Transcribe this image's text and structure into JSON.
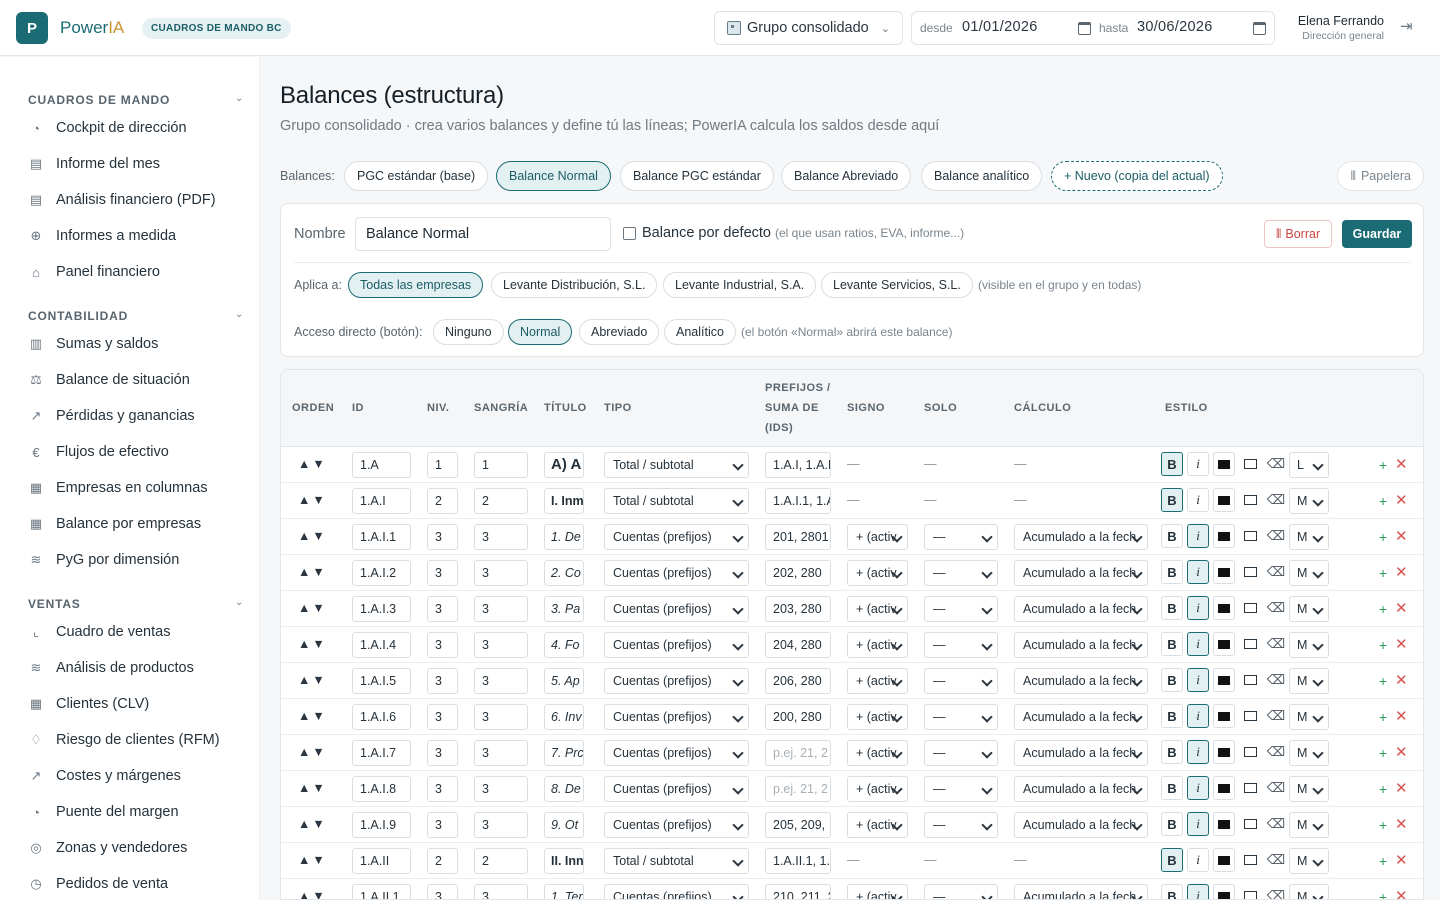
{
  "header": {
    "logo_letter": "P",
    "brand_a": "Power",
    "brand_b": "IA",
    "badge": "CUADROS DE MANDO BC",
    "group": "Grupo consolidado",
    "from_label": "desde",
    "from_date": "01/01/2026",
    "to_label": "hasta",
    "to_date": "30/06/2026",
    "user_name": "Elena Ferrando",
    "user_role": "Dirección general"
  },
  "sidebar": {
    "sections": [
      {
        "title": "CUADROS DE MANDO",
        "items": [
          {
            "label": "Cockpit de dirección",
            "icon": "gauge-icon",
            "glyph": "◔"
          },
          {
            "label": "Informe del mes",
            "icon": "document-icon",
            "glyph": "▤"
          },
          {
            "label": "Análisis financiero (PDF)",
            "icon": "document-icon",
            "glyph": "▤"
          },
          {
            "label": "Informes a medida",
            "icon": "plus-circle-icon",
            "glyph": "⊕"
          },
          {
            "label": "Panel financiero",
            "icon": "home-icon",
            "glyph": "⌂"
          }
        ]
      },
      {
        "title": "CONTABILIDAD",
        "items": [
          {
            "label": "Sumas y saldos",
            "icon": "book-icon",
            "glyph": "▥"
          },
          {
            "label": "Balance de situación",
            "icon": "scale-icon",
            "glyph": "⚖"
          },
          {
            "label": "Pérdidas y ganancias",
            "icon": "trend-icon",
            "glyph": "↗"
          },
          {
            "label": "Flujos de efectivo",
            "icon": "euro-icon",
            "glyph": "€"
          },
          {
            "label": "Empresas en columnas",
            "icon": "building-icon",
            "glyph": "▦"
          },
          {
            "label": "Balance por empresas",
            "icon": "building-icon",
            "glyph": "▦"
          },
          {
            "label": "PyG por dimensión",
            "icon": "layers-icon",
            "glyph": "≋"
          }
        ]
      },
      {
        "title": "VENTAS",
        "items": [
          {
            "label": "Cuadro de ventas",
            "icon": "line-chart-icon",
            "glyph": "⌞"
          },
          {
            "label": "Análisis de productos",
            "icon": "layers-icon",
            "glyph": "≋"
          },
          {
            "label": "Clientes (CLV)",
            "icon": "building-icon",
            "glyph": "▦"
          },
          {
            "label": "Riesgo de clientes (RFM)",
            "icon": "bell-icon",
            "glyph": "♢"
          },
          {
            "label": "Costes y márgenes",
            "icon": "trend-icon",
            "glyph": "↗"
          },
          {
            "label": "Puente del margen",
            "icon": "gauge-icon",
            "glyph": "◔"
          },
          {
            "label": "Zonas y vendedores",
            "icon": "target-icon",
            "glyph": "◎"
          },
          {
            "label": "Pedidos de venta",
            "icon": "clock-icon",
            "glyph": "◷"
          }
        ]
      }
    ]
  },
  "page": {
    "title": "Balances (estructura)",
    "subtitle": "Grupo consolidado · crea varios balances y define tú las líneas; PowerIA calcula los saldos desde aquí",
    "balances_label": "Balances:",
    "balances": [
      "PGC estándar (base)",
      "Balance Normal",
      "Balance PGC estándar",
      "Balance Abreviado",
      "Balance analítico"
    ],
    "new_balance": "+ Nuevo (copia del actual)",
    "trash": "Papelera"
  },
  "form": {
    "name_label": "Nombre",
    "name_value": "Balance Normal",
    "default_label": "Balance por defecto",
    "default_hint": "(el que usan ratios, EVA, informe...)",
    "delete": "Borrar",
    "save": "Guardar",
    "applies_label": "Aplica a:",
    "applies": [
      "Todas las empresas",
      "Levante Distribución, S.L.",
      "Levante Industrial, S.A.",
      "Levante Servicios, S.L."
    ],
    "applies_hint": "(visible en el grupo y en todas)",
    "shortcut_label": "Acceso directo (botón):",
    "shortcuts": [
      "Ninguno",
      "Normal",
      "Abreviado",
      "Analítico"
    ],
    "shortcut_hint": "(el botón «Normal» abrirá este balance)"
  },
  "table": {
    "headers": {
      "orden": "ORDEN",
      "id": "ID",
      "niv": "NIV.",
      "sangria": "SANGRÍA",
      "titulo": "TÍTULO",
      "tipo": "TIPO",
      "prefijos1": "PREFIJOS /",
      "prefijos2": "SUMA DE",
      "prefijos3": "(IDS)",
      "signo": "SIGNO",
      "solo": "SOLO",
      "calculo": "CÁLCULO",
      "estilo": "ESTILO"
    },
    "rows": [
      {
        "id": "1.A",
        "niv": "1",
        "sang": "1",
        "titulo": "A) A",
        "tipo": "Total / subtotal",
        "pref": "1.A.I, 1.A.I",
        "signo": "—",
        "solo": "—",
        "calc": "—",
        "size": "L",
        "bold": true,
        "italic": false
      },
      {
        "id": "1.A.I",
        "niv": "2",
        "sang": "2",
        "titulo": "I. Inm",
        "tipo": "Total / subtotal",
        "pref": "1.A.I.1, 1.A",
        "signo": "—",
        "solo": "—",
        "calc": "—",
        "size": "M",
        "bold": true,
        "italic": false
      },
      {
        "id": "1.A.I.1",
        "niv": "3",
        "sang": "3",
        "titulo": "1. De",
        "tipo": "Cuentas (prefijos)",
        "pref": "201, 2801",
        "signo": "+ (activ",
        "solo": "—",
        "calc": "Acumulado a la fech",
        "size": "M",
        "bold": false,
        "italic": true
      },
      {
        "id": "1.A.I.2",
        "niv": "3",
        "sang": "3",
        "titulo": "2. Co",
        "tipo": "Cuentas (prefijos)",
        "pref": "202, 280",
        "signo": "+ (activ",
        "solo": "—",
        "calc": "Acumulado a la fech",
        "size": "M",
        "bold": false,
        "italic": true
      },
      {
        "id": "1.A.I.3",
        "niv": "3",
        "sang": "3",
        "titulo": "3. Pa",
        "tipo": "Cuentas (prefijos)",
        "pref": "203, 280",
        "signo": "+ (activ",
        "solo": "—",
        "calc": "Acumulado a la fech",
        "size": "M",
        "bold": false,
        "italic": true
      },
      {
        "id": "1.A.I.4",
        "niv": "3",
        "sang": "3",
        "titulo": "4. Fo",
        "tipo": "Cuentas (prefijos)",
        "pref": "204, 280",
        "signo": "+ (activ",
        "solo": "—",
        "calc": "Acumulado a la fech",
        "size": "M",
        "bold": false,
        "italic": true
      },
      {
        "id": "1.A.I.5",
        "niv": "3",
        "sang": "3",
        "titulo": "5. Ap",
        "tipo": "Cuentas (prefijos)",
        "pref": "206, 280",
        "signo": "+ (activ",
        "solo": "—",
        "calc": "Acumulado a la fech",
        "size": "M",
        "bold": false,
        "italic": true
      },
      {
        "id": "1.A.I.6",
        "niv": "3",
        "sang": "3",
        "titulo": "6. Inv",
        "tipo": "Cuentas (prefijos)",
        "pref": "200, 280",
        "signo": "+ (activ",
        "solo": "—",
        "calc": "Acumulado a la fech",
        "size": "M",
        "bold": false,
        "italic": true
      },
      {
        "id": "1.A.I.7",
        "niv": "3",
        "sang": "3",
        "titulo": "7. Prc",
        "tipo": "Cuentas (prefijos)",
        "pref": "p.ej. 21, 2",
        "prefph": true,
        "signo": "+ (activ",
        "solo": "—",
        "calc": "Acumulado a la fech",
        "size": "M",
        "bold": false,
        "italic": true
      },
      {
        "id": "1.A.I.8",
        "niv": "3",
        "sang": "3",
        "titulo": "8. De",
        "tipo": "Cuentas (prefijos)",
        "pref": "p.ej. 21, 2",
        "prefph": true,
        "signo": "+ (activ",
        "solo": "—",
        "calc": "Acumulado a la fech",
        "size": "M",
        "bold": false,
        "italic": true
      },
      {
        "id": "1.A.I.9",
        "niv": "3",
        "sang": "3",
        "titulo": "9. Ot",
        "tipo": "Cuentas (prefijos)",
        "pref": "205, 209,",
        "signo": "+ (activ",
        "solo": "—",
        "calc": "Acumulado a la fech",
        "size": "M",
        "bold": false,
        "italic": true
      },
      {
        "id": "1.A.II",
        "niv": "2",
        "sang": "2",
        "titulo": "II. Inn",
        "tipo": "Total / subtotal",
        "pref": "1.A.II.1, 1.A",
        "signo": "—",
        "solo": "—",
        "calc": "—",
        "size": "M",
        "bold": true,
        "italic": false
      },
      {
        "id": "1.A.II.1",
        "niv": "3",
        "sang": "3",
        "titulo": "1. Ter",
        "tipo": "Cuentas (prefijos)",
        "pref": "210, 211, 2",
        "signo": "+ (activ",
        "solo": "—",
        "calc": "Acumulado a la fech",
        "size": "M",
        "bold": false,
        "italic": true
      }
    ]
  }
}
